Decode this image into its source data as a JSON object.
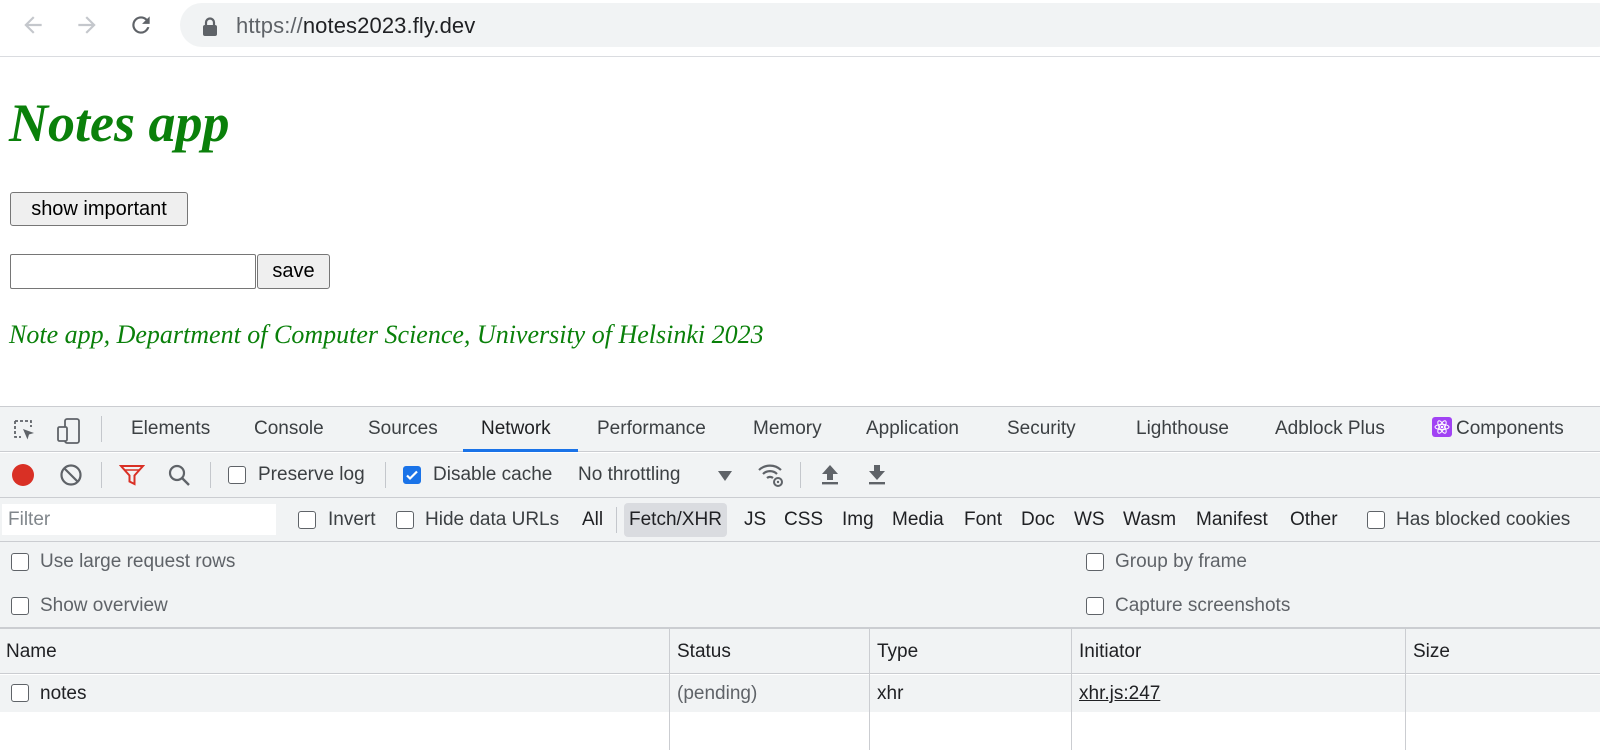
{
  "browser": {
    "url_scheme": "https://",
    "url_host": "notes2023.fly.dev"
  },
  "page": {
    "title": "Notes app",
    "show_button_label": "show important",
    "note_input_value": "",
    "save_button_label": "save",
    "footer_text": "Note app, Department of Computer Science, University of Helsinki 2023"
  },
  "devtools": {
    "tabs": [
      "Elements",
      "Console",
      "Sources",
      "Network",
      "Performance",
      "Memory",
      "Application",
      "Security",
      "Lighthouse",
      "Adblock Plus",
      "Components"
    ],
    "active_tab": "Network",
    "toolbar": {
      "preserve_log_label": "Preserve log",
      "preserve_log_checked": false,
      "disable_cache_label": "Disable cache",
      "disable_cache_checked": true,
      "throttling_value": "No throttling"
    },
    "filterbar": {
      "filter_placeholder": "Filter",
      "invert_label": "Invert",
      "hide_data_urls_label": "Hide data URLs",
      "types": [
        "All",
        "Fetch/XHR",
        "JS",
        "CSS",
        "Img",
        "Media",
        "Font",
        "Doc",
        "WS",
        "Wasm",
        "Manifest",
        "Other"
      ],
      "active_type": "Fetch/XHR",
      "has_blocked_cookies_label": "Has blocked cookies"
    },
    "settings": {
      "large_rows_label": "Use large request rows",
      "show_overview_label": "Show overview",
      "group_by_frame_label": "Group by frame",
      "capture_screenshots_label": "Capture screenshots"
    },
    "table": {
      "columns": [
        "Name",
        "Status",
        "Type",
        "Initiator",
        "Size"
      ],
      "rows": [
        {
          "name": "notes",
          "status": "(pending)",
          "type": "xhr",
          "initiator": "xhr.js:247",
          "size": ""
        }
      ]
    },
    "colors": {
      "record_red": "#d93025",
      "filter_red": "#d93025",
      "active_blue": "#1a73e8",
      "components_purple": "#a142f4"
    }
  },
  "colors": {
    "page_green": "#0a800a"
  }
}
